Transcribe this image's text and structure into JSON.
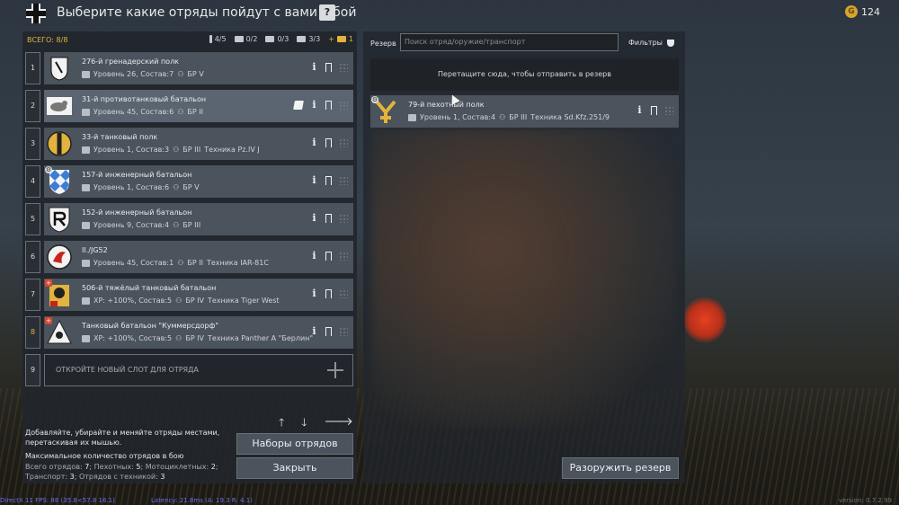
{
  "title": "Выберите какие отряды пойдут с вами в бой",
  "help": "?",
  "gold": "124",
  "summary": {
    "total": "ВСЕГО: 8/8",
    "counts": [
      {
        "icon": "infantry-icon",
        "value": "4/5"
      },
      {
        "icon": "engineer-icon",
        "value": "0/2"
      },
      {
        "icon": "motorcycle-icon",
        "value": "0/3"
      },
      {
        "icon": "tank-icon",
        "value": "3/3"
      },
      {
        "icon": "premium-tank-icon",
        "value": "1",
        "prefix": "+",
        "gold": true
      }
    ]
  },
  "slots": [
    {
      "num": "1",
      "name": "276-й гренадерский полк",
      "stats": "Уровень 26, Состав:7",
      "br": "БР V",
      "tech": "",
      "emblem": "emblem-276"
    },
    {
      "num": "2",
      "name": "31-й противотанковый батальон",
      "stats": "Уровень 45, Состав:6",
      "br": "БР II",
      "tech": "",
      "emblem": "emblem-31",
      "selected": true
    },
    {
      "num": "3",
      "name": "33-й танковый полк",
      "stats": "Уровень 1, Состав:3",
      "br": "БР III",
      "tech": "Техника Pz.IV J",
      "emblem": "emblem-33"
    },
    {
      "num": "4",
      "name": "157-й инженерный батальон",
      "stats": "Уровень 1, Состав:6",
      "br": "БР V",
      "tech": "",
      "emblem": "emblem-157"
    },
    {
      "num": "5",
      "name": "152-й инженерный батальон",
      "stats": "Уровень 9, Состав:4",
      "br": "БР III",
      "tech": "",
      "emblem": "emblem-152"
    },
    {
      "num": "6",
      "name": "II./JG52",
      "stats": "Уровень 45, Состав:1",
      "br": "БР II",
      "tech": "Техника IAR-81C",
      "emblem": "emblem-jg52"
    },
    {
      "num": "7",
      "name": "506-й тяжёлый танковый батальон",
      "stats": "XP: +100%, Состав:5",
      "br": "БР IV",
      "tech": "Техника Tiger West",
      "emblem": "emblem-506"
    },
    {
      "num": "8",
      "name": "Танковый батальон \"Куммерсдорф\"",
      "stats": "XP: +100%, Состав:5",
      "br": "БР IV",
      "tech": "Техника Panther A \"Берлин\"",
      "emblem": "emblem-kummersdorf"
    }
  ],
  "open_slot": {
    "num": "9",
    "label": "ОТКРОЙТЕ НОВЫЙ СЛОТ ДЛЯ ОТРЯДА"
  },
  "hint": "Добавляйте, убирайте и меняйте отряды местами, перетаскивая их мышью.",
  "max": {
    "title": "Максимальное количество отрядов в бою",
    "all_label": "Всего отрядов:",
    "all": "7",
    "inf_label": "Пехотных:",
    "inf": "5",
    "moto_label": "Мотоциклетных:",
    "moto": "2",
    "trans_label": "Транспорт:",
    "trans": "3",
    "tech_label": "Отрядов с техникой:",
    "tech": "3"
  },
  "buttons": {
    "presets": "Наборы отрядов",
    "close": "Закрыть",
    "disarm": "Разоружить резерв"
  },
  "reserve": {
    "label": "Резерв",
    "search_placeholder": "Поиск отряд/оружие/транспорт",
    "filters": "Фильтры",
    "dropzone": "Перетащите сюда, чтобы отправить в резерв",
    "unit": {
      "name": "79-й пехотный полк",
      "stats": "Уровень 1, Состав:4",
      "br": "БР III",
      "tech": "Техника Sd.Kfz.251/9"
    }
  },
  "footer": {
    "left": "DirectX 11 FPS: 88 (35.8<57.8 16.1)",
    "mid": "Latency: 21.8ms (A: 19.3 R: 4.1)",
    "right": "version: 0.7.2.99"
  }
}
